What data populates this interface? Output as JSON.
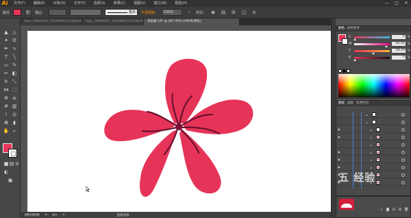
{
  "menubar": {
    "logo": "Ai",
    "items": [
      "文件(F)",
      "编辑(E)",
      "对象(O)",
      "文字(T)",
      "选择(S)",
      "效果(C)",
      "视图(V)",
      "窗口(W)",
      "帮助(H)"
    ],
    "window_controls": [
      "—",
      "□",
      "✕"
    ]
  },
  "controlbar": {
    "path_label": "路径",
    "fill_color": "#e63458",
    "stroke_label": "描边：",
    "stroke_weight": "",
    "stroke_style": "基本",
    "warning": "不透明度：",
    "opacity": "100%",
    "style_label": "样式："
  },
  "tabs": [
    {
      "label": "hipic_29842067_20190601411584163000.ai* @ 16..."
    },
    {
      "label": "hipic_29842067_20190603121436163000.ai @ 25..."
    },
    {
      "label": "未标题-19* @ 407.45% (CMYK/预览)",
      "active": true
    }
  ],
  "statusbar": {
    "zoom": "407.45%",
    "page": "1",
    "mode": "直接选择"
  },
  "color_panel": {
    "tabs": [
      "颜色",
      "颜色参考"
    ],
    "fill": "#e63458",
    "channels": [
      {
        "name": "C",
        "value": "0",
        "track": "linear-gradient(to right,#e9345a,#3fb3e6)",
        "position": 0.0
      },
      {
        "name": "M",
        "value": "92.54",
        "track": "linear-gradient(to right,#fff 0%,#e6007e 100%)",
        "position": 0.93
      },
      {
        "name": "Y",
        "value": "54.29",
        "track": "linear-gradient(to right,#e63458,#ffb03a)",
        "position": 0.54
      },
      {
        "name": "K",
        "value": "0",
        "track": "linear-gradient(to right,#e63458,#1a0a0e)",
        "position": 0.0
      }
    ]
  },
  "layers_panel": {
    "tabs": [
      "图层",
      "画板",
      "资源导出"
    ]
  },
  "watermark": "五 经验"
}
